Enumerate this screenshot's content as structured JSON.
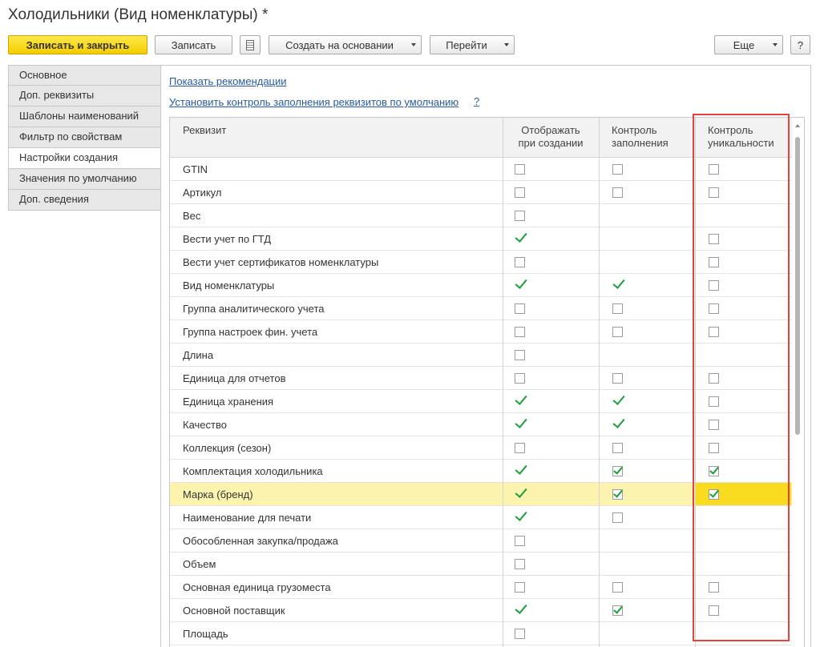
{
  "window": {
    "title": "Холодильники (Вид номенклатуры) *"
  },
  "toolbar": {
    "save_close": "Записать и закрыть",
    "save": "Записать",
    "list_icon": "list-icon",
    "create_based": "Создать на основании",
    "goto": "Перейти",
    "more": "Еще",
    "help": "?"
  },
  "nav": {
    "items": [
      {
        "label": "Основное",
        "active": false
      },
      {
        "label": "Доп. реквизиты",
        "active": false
      },
      {
        "label": "Шаблоны наименований",
        "active": false
      },
      {
        "label": "Фильтр по свойствам",
        "active": false
      },
      {
        "label": "Настройки создания",
        "active": true
      },
      {
        "label": "Значения по умолчанию",
        "active": false
      },
      {
        "label": "Доп. сведения",
        "active": false
      }
    ]
  },
  "links": {
    "recommendations": "Показать рекомендации",
    "default_control": "Установить контроль заполнения реквизитов по умолчанию",
    "help": "?"
  },
  "table": {
    "columns": {
      "attr": "Реквизит",
      "show_line1": "Отображать",
      "show_line2": "при создании",
      "fill_line1": "Контроль",
      "fill_line2": "заполнения",
      "unique_line1": "Контроль",
      "unique_line2": "уникальности"
    },
    "rows": [
      {
        "name": "GTIN",
        "show": "empty",
        "fill": "empty",
        "unique": "empty"
      },
      {
        "name": "Артикул",
        "show": "empty",
        "fill": "empty",
        "unique": "empty"
      },
      {
        "name": "Вес",
        "show": "empty",
        "fill": "none",
        "unique": "none"
      },
      {
        "name": "Вести учет по ГТД",
        "show": "tick",
        "fill": "none",
        "unique": "empty"
      },
      {
        "name": "Вести учет сертификатов номенклатуры",
        "show": "empty",
        "fill": "none",
        "unique": "empty"
      },
      {
        "name": "Вид номенклатуры",
        "show": "tick",
        "fill": "tick",
        "unique": "empty"
      },
      {
        "name": "Группа аналитического учета",
        "show": "empty",
        "fill": "empty",
        "unique": "empty"
      },
      {
        "name": "Группа настроек фин. учета",
        "show": "empty",
        "fill": "empty",
        "unique": "empty"
      },
      {
        "name": "Длина",
        "show": "empty",
        "fill": "none",
        "unique": "none"
      },
      {
        "name": "Единица для отчетов",
        "show": "empty",
        "fill": "empty",
        "unique": "empty"
      },
      {
        "name": "Единица хранения",
        "show": "tick",
        "fill": "tick",
        "unique": "empty"
      },
      {
        "name": "Качество",
        "show": "tick",
        "fill": "tick",
        "unique": "empty"
      },
      {
        "name": "Коллекция (сезон)",
        "show": "empty",
        "fill": "empty",
        "unique": "empty"
      },
      {
        "name": "Комплектация холодильника",
        "show": "tick",
        "fill": "checked",
        "unique": "checked"
      },
      {
        "name": "Марка (бренд)",
        "show": "tick",
        "fill": "checked",
        "unique": "checked",
        "selected": true
      },
      {
        "name": "Наименование для печати",
        "show": "tick",
        "fill": "empty",
        "unique": "none"
      },
      {
        "name": "Обособленная закупка/продажа",
        "show": "empty",
        "fill": "none",
        "unique": "none"
      },
      {
        "name": "Объем",
        "show": "empty",
        "fill": "none",
        "unique": "none"
      },
      {
        "name": "Основная единица грузоместа",
        "show": "empty",
        "fill": "empty",
        "unique": "empty"
      },
      {
        "name": "Основной поставщик",
        "show": "tick",
        "fill": "checked",
        "unique": "empty"
      },
      {
        "name": "Площадь",
        "show": "empty",
        "fill": "none",
        "unique": "none"
      }
    ]
  },
  "colors": {
    "accent": "#f3cd00",
    "selection": "#fcf4ae",
    "highlight_box": "#e5413f",
    "check": "#1c9e3a",
    "link": "#2a5a9c"
  }
}
